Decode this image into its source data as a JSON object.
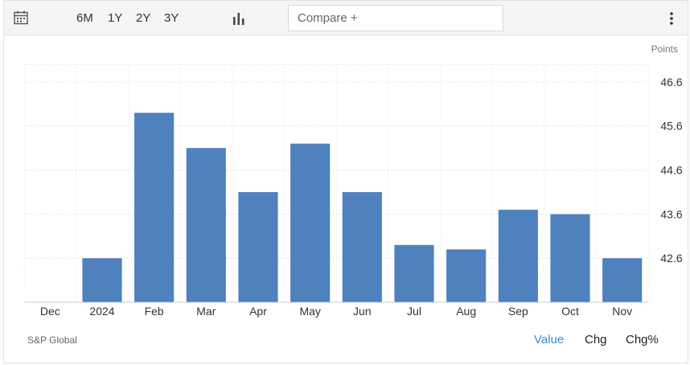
{
  "toolbar": {
    "calendar_icon": "calendar-icon",
    "ranges": [
      "6M",
      "1Y",
      "2Y",
      "3Y"
    ],
    "chart_type_icon": "bar-chart-icon",
    "compare_placeholder": "Compare +",
    "menu_icon": "vertical-dots-icon"
  },
  "units_label": "Points",
  "source": "S&P Global",
  "modes": [
    "Value",
    "Chg",
    "Chg%"
  ],
  "active_mode": "Value",
  "colors": {
    "bar": "#4e81bd",
    "active_mode": "#3a8fd6",
    "grid": "#e6e6e6"
  },
  "chart_data": {
    "type": "bar",
    "categories": [
      "Dec",
      "2024",
      "Feb",
      "Mar",
      "Apr",
      "May",
      "Jun",
      "Jul",
      "Aug",
      "Sep",
      "Oct",
      "Nov"
    ],
    "values": [
      41.6,
      42.6,
      45.9,
      45.1,
      44.1,
      45.2,
      44.1,
      42.9,
      42.8,
      43.7,
      43.6,
      42.6
    ],
    "y_ticks": [
      "42.6",
      "43.6",
      "44.6",
      "45.6",
      "46.6"
    ],
    "ylim": [
      41.6,
      47.0
    ],
    "axis_side": "right",
    "grid": true
  }
}
